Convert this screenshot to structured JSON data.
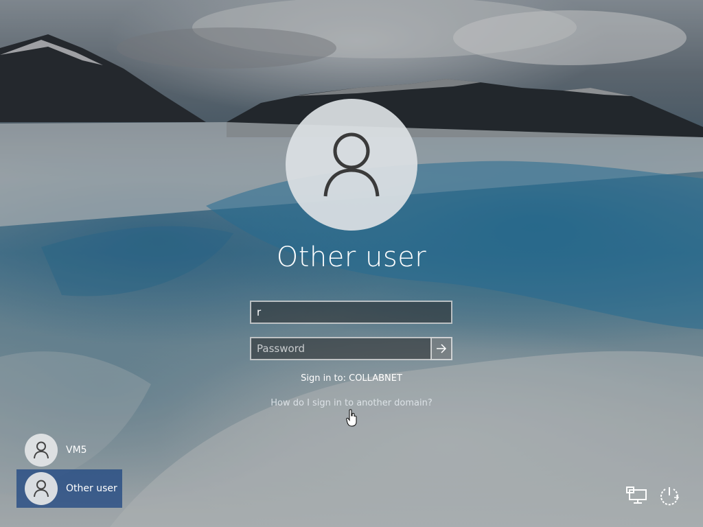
{
  "login": {
    "display_name": "Other user",
    "username_value": "r",
    "password_placeholder": "Password",
    "sign_in_to": "Sign in to: COLLABNET",
    "help_link": "How do I sign in to another domain?"
  },
  "users": [
    {
      "name": "VM5",
      "selected": false
    },
    {
      "name": "Other user",
      "selected": true
    }
  ],
  "icons": {
    "large_avatar": "person-icon",
    "submit": "arrow-right-icon",
    "network": "network-icon",
    "power": "power-icon"
  },
  "colors": {
    "selected_user_bg": "#1e4682",
    "field_border": "#cfd3d6"
  }
}
